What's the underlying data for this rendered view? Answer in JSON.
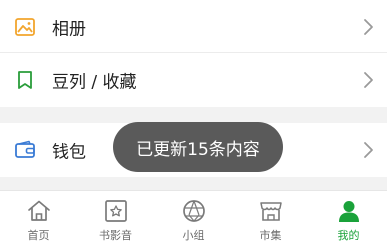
{
  "menu": {
    "items": [
      {
        "label": "相册",
        "icon": "photo-album-icon"
      },
      {
        "label": "豆列 / 收藏",
        "icon": "bookmark-icon"
      },
      {
        "label": "钱包",
        "icon": "wallet-icon"
      }
    ]
  },
  "toast": {
    "text": "已更新15条内容"
  },
  "tabbar": {
    "tabs": [
      {
        "label": "首页",
        "icon": "home-icon",
        "active": false
      },
      {
        "label": "书影音",
        "icon": "book-film-music-icon",
        "active": false
      },
      {
        "label": "小组",
        "icon": "group-icon",
        "active": false
      },
      {
        "label": "市集",
        "icon": "market-icon",
        "active": false
      },
      {
        "label": "我的",
        "icon": "profile-icon",
        "active": true
      }
    ]
  },
  "colors": {
    "accent": "#1aa23a",
    "album_icon": "#f2a52d",
    "bookmark_icon": "#2a9d3a",
    "wallet_icon": "#3a7bd5",
    "toast_bg": "#5a5a5a"
  }
}
